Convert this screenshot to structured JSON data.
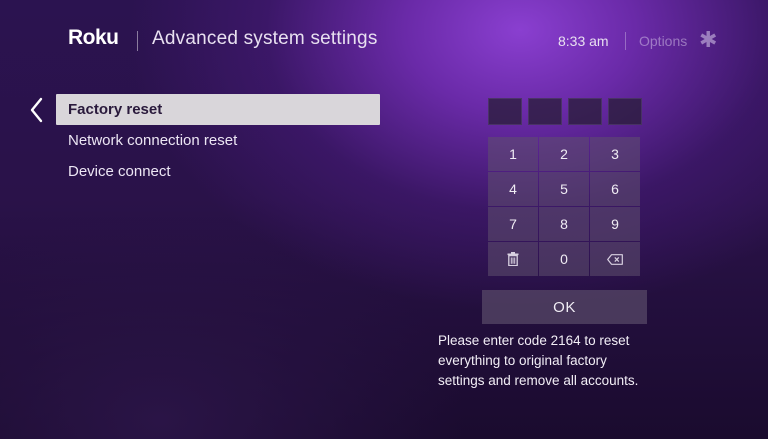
{
  "header": {
    "logo": "Roku",
    "title": "Advanced system settings",
    "time": "8:33 am",
    "options_label": "Options",
    "options_icon": "asterisk-icon"
  },
  "menu": {
    "back_icon": "chevron-left-icon",
    "items": [
      {
        "label": "Factory reset",
        "selected": true
      },
      {
        "label": "Network connection reset",
        "selected": false
      },
      {
        "label": "Device connect",
        "selected": false
      }
    ]
  },
  "code_entry": {
    "slots": 4,
    "digits": [
      "",
      "",
      "",
      ""
    ]
  },
  "keypad": {
    "keys": [
      "1",
      "2",
      "3",
      "4",
      "5",
      "6",
      "7",
      "8",
      "9",
      "trash-icon",
      "0",
      "backspace-icon"
    ]
  },
  "ok_button": {
    "label": "OK"
  },
  "message": {
    "lines": [
      "Please enter code 2164 to reset",
      "everything to original factory",
      "settings and remove all accounts."
    ]
  },
  "colors": {
    "selected_bg": "#d9d6da",
    "selected_text": "#2a1a3c",
    "key_bg": "#5f506e",
    "background_accent": "#6a2aa8"
  }
}
